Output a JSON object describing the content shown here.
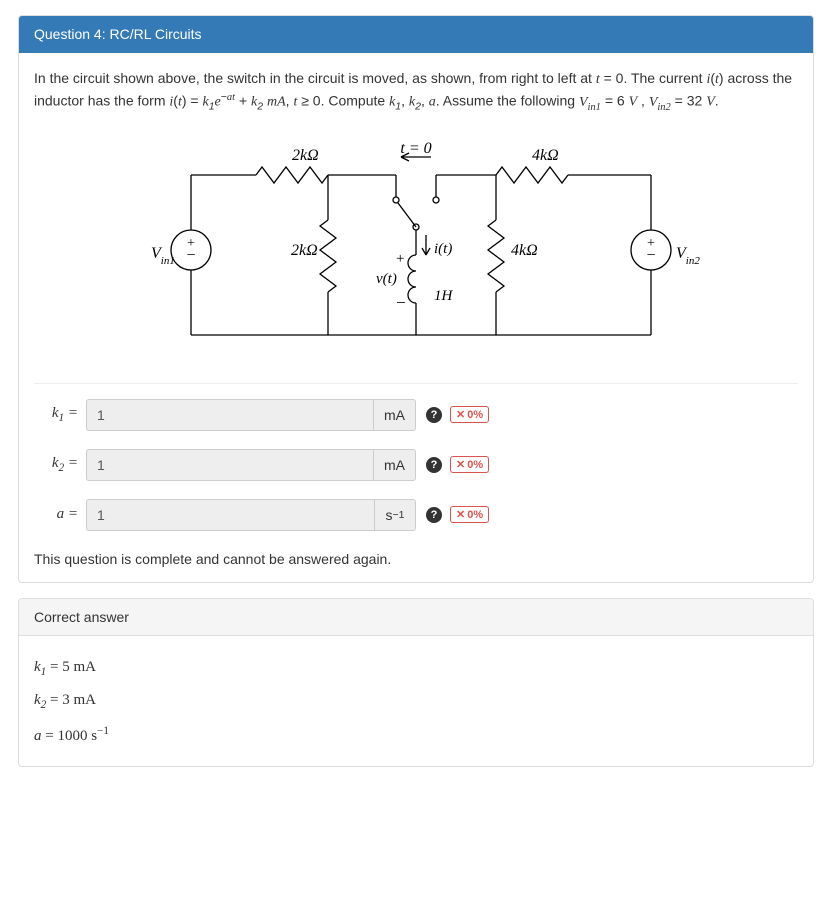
{
  "question": {
    "header": "Question 4: RC/RL Circuits",
    "text_html": "In the circuit shown above, the switch in the circuit is moved, as shown, from right to left at <span class='math'>t</span> = 0. The current <span class='math'>i</span>(<span class='math'>t</span>) across the inductor has the form <span class='math'>i</span>(<span class='math'>t</span>) = <span class='math'>k</span><span class='sub'>1</span><span class='math'>e</span><span class='sup'>−<span class='math'>at</span></span> + <span class='math'>k</span><span class='sub'>2</span> <span class='math'>mA</span>, <span class='math'>t</span> ≥ 0. Compute <span class='math'>k</span><span class='sub'>1</span>, <span class='math'>k</span><span class='sub'>2</span>, <span class='math'>a</span>. Assume the following <span class='math'>V<span class='sub'>in1</span></span> = 6 <span class='math'>V</span> , <span class='math'>V<span class='sub'>in2</span></span> = 32 <span class='math'>V</span>."
  },
  "circuit": {
    "r_top_left": "2kΩ",
    "r_top_right": "4kΩ",
    "r_mid_left": "2kΩ",
    "r_mid_right": "4kΩ",
    "t0": "t = 0",
    "vin1": "Vin1",
    "vin2": "Vin2",
    "i_t": "i(t)",
    "v_t": "v(t)",
    "L": "1H",
    "plus": "+",
    "minus": "−"
  },
  "rows": {
    "k1": {
      "label_html": "<span class='math'>k</span><span class='sub'>1</span> =",
      "value": "1",
      "unit_html": "mA",
      "score": "0%"
    },
    "k2": {
      "label_html": "<span class='math'>k</span><span class='sub'>2</span> =",
      "value": "1",
      "unit_html": "mA",
      "score": "0%"
    },
    "a": {
      "label_html": "<span class='math'>a</span> =",
      "value": "1",
      "unit_html": "s<span class='sup'>−1</span>",
      "score": "0%"
    }
  },
  "complete_msg": "This question is complete and cannot be answered again.",
  "correct": {
    "header": "Correct answer",
    "k1_html": "<span class='math'>k</span><span class='sub'>1</span> = 5 mA",
    "k2_html": "<span class='math'>k</span><span class='sub'>2</span> = 3 mA",
    "a_html": "<span class='math'>a</span> = 1000 s<span class='sup'>−1</span>"
  }
}
